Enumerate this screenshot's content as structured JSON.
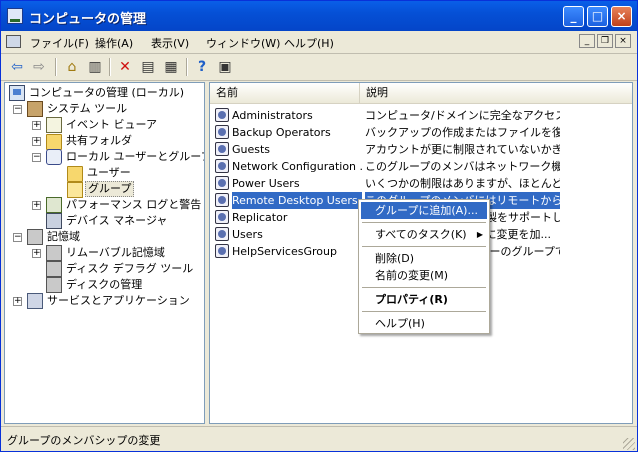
{
  "window": {
    "title": "コンピュータの管理"
  },
  "title_buttons": {
    "minimize": "_",
    "maximize": "□",
    "close": "×"
  },
  "menu": [
    "ファイル(F)",
    "操作(A)",
    "表示(V)",
    "ウィンドウ(W)",
    "ヘルプ(H)"
  ],
  "mdi_buttons": {
    "minimize": "_",
    "restore": "❐",
    "close": "×"
  },
  "toolbar": {
    "back": "⇦",
    "forward": "⇨",
    "up": "⌂",
    "show_tree": "▥",
    "delete": "✕",
    "properties": "▤",
    "export": "▦",
    "help": "?",
    "console": "▣"
  },
  "tree": {
    "root": "コンピュータの管理 (ローカル)",
    "system_tools": "システム ツール",
    "event_viewer": "イベント ビューア",
    "shared_folders": "共有フォルダ",
    "local_users_groups": "ローカル ユーザーとグループ",
    "users": "ユーザー",
    "groups": "グループ",
    "performance": "パフォーマンス ログと警告",
    "device_manager": "デバイス マネージャ",
    "storage": "記憶域",
    "removable": "リムーバブル記憶域",
    "defrag": "ディスク デフラグ ツール",
    "disk_mgmt": "ディスクの管理",
    "services_apps": "サービスとアプリケーション"
  },
  "list": {
    "columns": {
      "name": "名前",
      "description": "説明"
    },
    "rows": [
      {
        "name": "Administrators",
        "description": "コンピュータ/ドメインに完全なアクセス..."
      },
      {
        "name": "Backup Operators",
        "description": "バックアップの作成またはファイルを復元..."
      },
      {
        "name": "Guests",
        "description": "アカウントが更に制限されていないかぎ..."
      },
      {
        "name": "Network Configuration ...",
        "description": "このグループのメンバはネットワーク機能..."
      },
      {
        "name": "Power Users",
        "description": "いくつかの制限はありますが、ほとんどの..."
      },
      {
        "name": "Remote Desktop Users",
        "description": "このグループのメンバにはリモートからログ..."
      },
      {
        "name": "Replicator",
        "description": "ドメイン内のファイル複製をサポートしま..."
      },
      {
        "name": "Users",
        "description": "ユーザーがシステム全体に変更を加..."
      },
      {
        "name": "HelpServicesGroup",
        "description": "ヘルプとサポート センターのグループで..."
      }
    ]
  },
  "context_menu": {
    "add_to_group": "グループに追加(A)...",
    "all_tasks": "すべてのタスク(K)",
    "delete": "削除(D)",
    "rename": "名前の変更(M)",
    "properties": "プロパティ(R)",
    "help": "ヘルプ(H)"
  },
  "status": {
    "text": "グループのメンバシップの変更"
  },
  "colors": {
    "title_bar": "#0550d6",
    "selection": "#316ac5",
    "window_bg": "#ece9d8"
  }
}
